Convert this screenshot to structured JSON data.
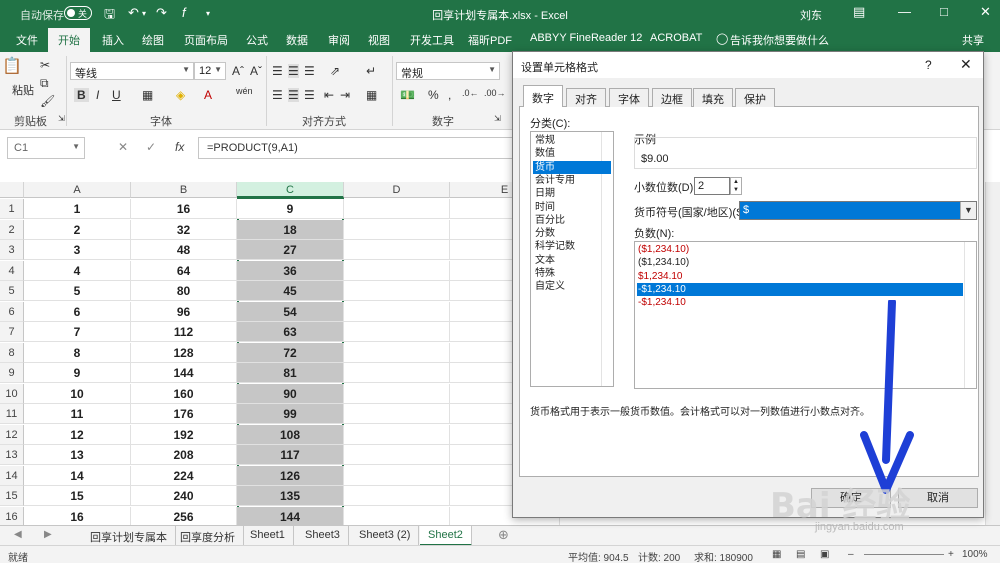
{
  "app": {
    "autosave_label": "自动保存",
    "autosave_state": "关",
    "doc_title": "回享计划专属本.xlsx  -  Excel",
    "user": "刘东",
    "share": "共享"
  },
  "ribbon_tabs": [
    "文件",
    "开始",
    "插入",
    "绘图",
    "页面布局",
    "公式",
    "数据",
    "审阅",
    "视图",
    "开发工具",
    "福昕PDF",
    "ABBYY FineReader 12",
    "ACROBAT",
    "告诉我你想要做什么"
  ],
  "ribbon": {
    "paste_label": "粘贴",
    "font_name": "等线",
    "font_size": "12",
    "number_format": "常规",
    "wen_label": "wén",
    "groups": [
      "剪贴板",
      "字体",
      "对齐方式",
      "数字"
    ]
  },
  "formula_bar": {
    "name_box": "C1",
    "fx": "fx",
    "formula": "=PRODUCT(9,A1)"
  },
  "grid": {
    "columns": [
      "A",
      "B",
      "C",
      "D",
      "E"
    ],
    "rows": [
      {
        "n": "1",
        "a": "1",
        "b": "16",
        "c": "9"
      },
      {
        "n": "2",
        "a": "2",
        "b": "32",
        "c": "18"
      },
      {
        "n": "3",
        "a": "3",
        "b": "48",
        "c": "27"
      },
      {
        "n": "4",
        "a": "4",
        "b": "64",
        "c": "36"
      },
      {
        "n": "5",
        "a": "5",
        "b": "80",
        "c": "45"
      },
      {
        "n": "6",
        "a": "6",
        "b": "96",
        "c": "54"
      },
      {
        "n": "7",
        "a": "7",
        "b": "112",
        "c": "63"
      },
      {
        "n": "8",
        "a": "8",
        "b": "128",
        "c": "72"
      },
      {
        "n": "9",
        "a": "9",
        "b": "144",
        "c": "81"
      },
      {
        "n": "10",
        "a": "10",
        "b": "160",
        "c": "90"
      },
      {
        "n": "11",
        "a": "11",
        "b": "176",
        "c": "99"
      },
      {
        "n": "12",
        "a": "12",
        "b": "192",
        "c": "108"
      },
      {
        "n": "13",
        "a": "13",
        "b": "208",
        "c": "117"
      },
      {
        "n": "14",
        "a": "14",
        "b": "224",
        "c": "126"
      },
      {
        "n": "15",
        "a": "15",
        "b": "240",
        "c": "135"
      },
      {
        "n": "16",
        "a": "16",
        "b": "256",
        "c": "144"
      }
    ]
  },
  "sheets": [
    "回享计划专属本",
    "回享度分析",
    "Sheet1",
    "Sheet3",
    "Sheet3 (2)",
    "Sheet2"
  ],
  "active_sheet": "Sheet2",
  "status": {
    "mode": "就绪",
    "average": "平均值: 904.5",
    "count": "计数: 200",
    "sum": "求和: 180900",
    "zoom": "100%"
  },
  "dialog": {
    "title": "设置单元格格式",
    "help": "?",
    "tabs": [
      "数字",
      "对齐",
      "字体",
      "边框",
      "填充",
      "保护"
    ],
    "category_label": "分类(C):",
    "categories": [
      "常规",
      "数值",
      "货币",
      "会计专用",
      "日期",
      "时间",
      "百分比",
      "分数",
      "科学记数",
      "文本",
      "特殊",
      "自定义"
    ],
    "selected_category": "货币",
    "sample_label": "示例",
    "sample_value": "$9.00",
    "decimals_label": "小数位数(D):",
    "decimals_value": "2",
    "currency_label": "货币符号(国家/地区)(S):",
    "currency_value": "$",
    "negative_label": "负数(N):",
    "negatives": [
      {
        "text": "($1,234.10)",
        "color": "#c00000"
      },
      {
        "text": "($1,234.10)",
        "color": "#222222"
      },
      {
        "text": "$1,234.10",
        "color": "#c00000"
      },
      {
        "text": "-$1,234.10",
        "color": "#ffffff"
      },
      {
        "text": "-$1,234.10",
        "color": "#c00000"
      }
    ],
    "selected_negative": 3,
    "description": "货币格式用于表示一般货币数值。会计格式可以对一列数值进行小数点对齐。",
    "ok_label": "确定",
    "cancel_label": "取消"
  },
  "annotation": {
    "arrow_color": "#1e3fd6",
    "watermark": "Bai 经验",
    "watermark_sub": "jingyan.baidu.com"
  }
}
